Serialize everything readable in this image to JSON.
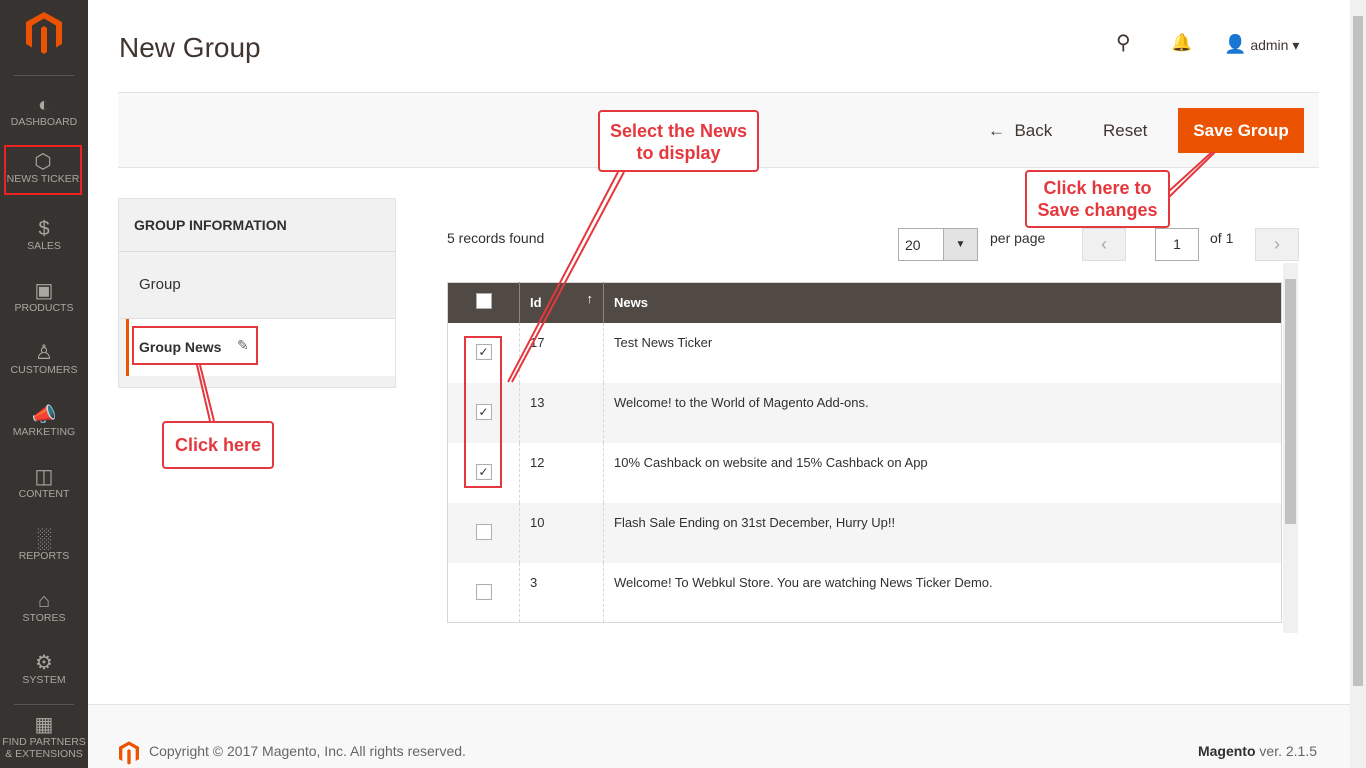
{
  "sidebar": {
    "items": [
      {
        "label": "DASHBOARD",
        "icon": "dashboard-icon"
      },
      {
        "label": "NEWS TICKER",
        "icon": "hexagon-icon"
      },
      {
        "label": "SALES",
        "icon": "dollar-icon"
      },
      {
        "label": "PRODUCTS",
        "icon": "box-icon"
      },
      {
        "label": "CUSTOMERS",
        "icon": "person-icon"
      },
      {
        "label": "MARKETING",
        "icon": "megaphone-icon"
      },
      {
        "label": "CONTENT",
        "icon": "layout-icon"
      },
      {
        "label": "REPORTS",
        "icon": "bar-chart-icon"
      },
      {
        "label": "STORES",
        "icon": "store-icon"
      },
      {
        "label": "SYSTEM",
        "icon": "gear-icon"
      },
      {
        "label": "FIND PARTNERS & EXTENSIONS",
        "icon": "blocks-icon"
      }
    ]
  },
  "header": {
    "title": "New Group",
    "user": "admin"
  },
  "actions": {
    "back": "Back",
    "reset": "Reset",
    "save": "Save Group"
  },
  "tabs": {
    "heading": "GROUP INFORMATION",
    "items": [
      "Group",
      "Group News"
    ]
  },
  "grid": {
    "records": "5 records found",
    "per_page_value": "20",
    "per_page_label": "per page",
    "page": "1",
    "of_pages": "of 1",
    "columns": [
      "Id",
      "News"
    ],
    "rows": [
      {
        "id": "17",
        "news": "Test News Ticker",
        "checked": true
      },
      {
        "id": "13",
        "news": "Welcome! to the World of Magento Add-ons.",
        "checked": true
      },
      {
        "id": "12",
        "news": "10% Cashback on website and 15% Cashback on App",
        "checked": true
      },
      {
        "id": "10",
        "news": "Flash Sale Ending on 31st December, Hurry Up!!",
        "checked": false
      },
      {
        "id": "3",
        "news": "Welcome! To Webkul Store. You are watching News Ticker Demo.",
        "checked": false
      }
    ]
  },
  "footer": {
    "copyright": "Copyright © 2017 Magento, Inc. All rights reserved.",
    "brand": "Magento",
    "version": "ver. 2.1.5"
  },
  "annotations": {
    "select": "Select the News to display",
    "save": "Click here to Save changes",
    "click": "Click here"
  },
  "colors": {
    "accent": "#eb5202",
    "sidebar": "#373330",
    "grid_header": "#514943",
    "annotation": "#e5383e"
  }
}
